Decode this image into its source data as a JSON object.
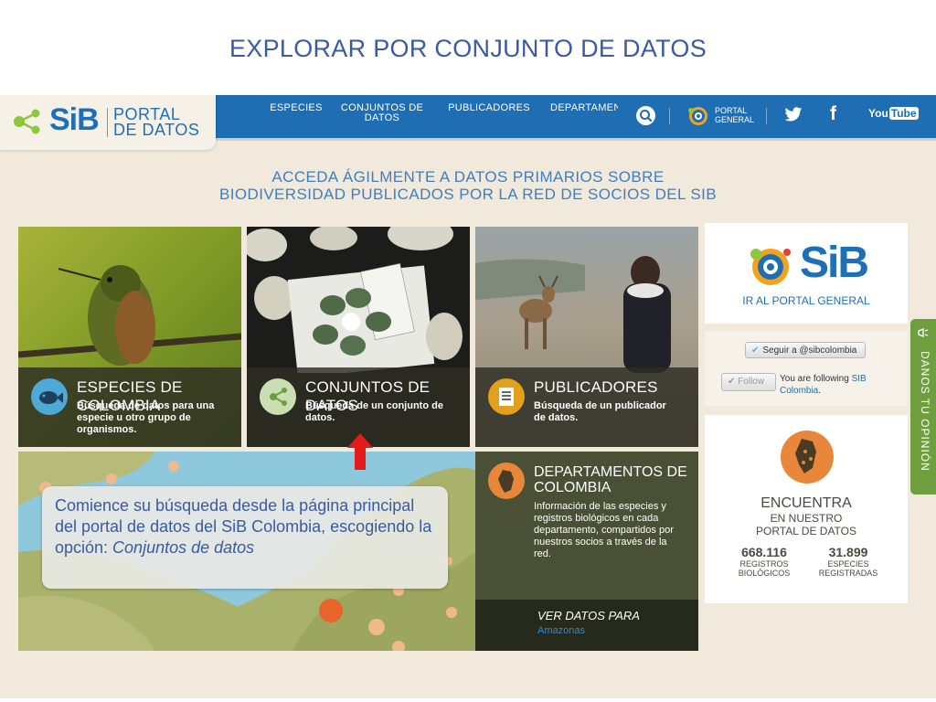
{
  "slide": {
    "title": "EXPLORAR POR CONJUNTO DE DATOS"
  },
  "header": {
    "logo": {
      "sib": "SiB",
      "portal_line1": "PORTAL",
      "portal_line2": "DE DATOS"
    },
    "nav": [
      {
        "label_line1": "ESPECIES",
        "label_line2": ""
      },
      {
        "label_line1": "CONJUNTOS DE",
        "label_line2": "DATOS"
      },
      {
        "label_line1": "PUBLICADORES",
        "label_line2": ""
      },
      {
        "label_line1": "DEPARTAMEN",
        "label_line2": ""
      }
    ],
    "portal_general_line1": "PORTAL",
    "portal_general_line2": "GENERAL",
    "twitter": "twitter-icon",
    "facebook": "f",
    "youtube_you": "You",
    "youtube_tube": "Tube"
  },
  "tagline": {
    "line1": "ACCEDA ÁGILMENTE A DATOS PRIMARIOS SOBRE",
    "line2": "BIODIVERSIDAD PUBLICADOS POR LA RED DE SOCIOS DEL SIB"
  },
  "tiles": {
    "especies": {
      "title": "ESPECIES DE COLOMBIA",
      "desc": "Búsqueda de datos para una especie u otro grupo de organismos."
    },
    "conjuntos": {
      "title": "CONJUNTOS DE DATOS",
      "desc": "Búsqueda de un conjunto de datos."
    },
    "publicadores": {
      "title": "PUBLICADORES",
      "desc": "Búsqueda de un publicador de datos."
    },
    "departamentos": {
      "title_line1": "DEPARTAMENTOS DE",
      "title_line2": "COLOMBIA",
      "desc": "Información de las especies y registros biológicos en cada departamento, compartidos por nuestros socios a través de la red.",
      "ver_datos": "VER DATOS PARA",
      "region": "Amazonas"
    }
  },
  "sidebar": {
    "sib_logo": "SiB",
    "ir_portal": "IR AL PORTAL GENERAL",
    "seguir": "Seguir a @sibcolombia",
    "follow": "Follow",
    "following_text": "You are following",
    "following_link_1": "SIB",
    "following_link_2": "Colombia",
    "encuentra": "ENCUENTRA",
    "en_nuestro": "EN NUESTRO",
    "portal_datos": "PORTAL DE DATOS",
    "registros_value": "668.116",
    "registros_label_1": "REGISTROS",
    "registros_label_2": "BIOLÓGICOS",
    "especies_value": "31.899",
    "especies_label_1": "ESPECIES",
    "especies_label_2": "REGISTRADAS"
  },
  "feedback": {
    "label": "DANOS TU OPINIÓN"
  },
  "callout": {
    "text_plain": "Comience su búsqueda desde la página principal del portal de datos del SiB Colombia, escogiendo la opción: ",
    "text_italic": "Conjuntos de datos"
  },
  "colors": {
    "nav_blue": "#1f6db3",
    "title_blue": "#3a5aa3",
    "accent_orange": "#e07b2e",
    "arrow_red": "#e31b1b",
    "feedback_green": "#6f9e3e"
  }
}
